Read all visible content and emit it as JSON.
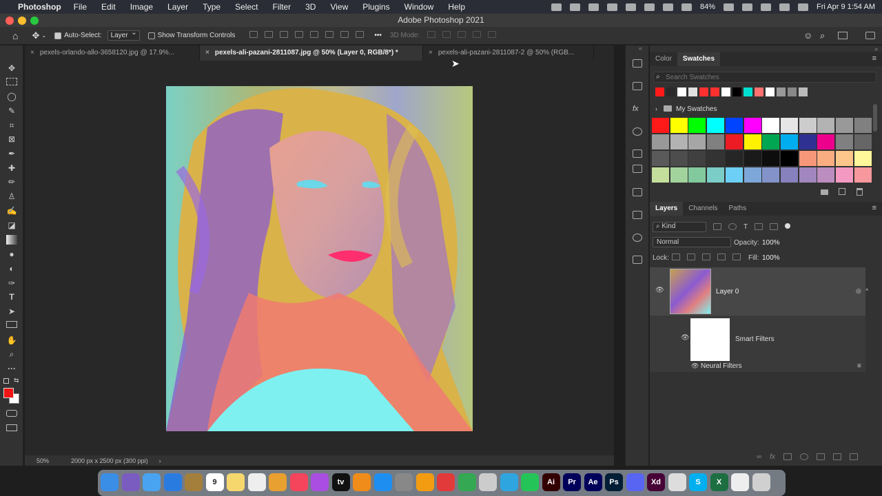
{
  "menubar": {
    "apple": "",
    "app": "Photoshop",
    "items": [
      "File",
      "Edit",
      "Image",
      "Layer",
      "Type",
      "Select",
      "Filter",
      "3D",
      "View",
      "Plugins",
      "Window",
      "Help"
    ],
    "battery": "84%",
    "datetime": "Fri Apr 9  1:54 AM"
  },
  "window": {
    "title": "Adobe Photoshop 2021"
  },
  "options": {
    "auto_select_label": "Auto-Select:",
    "auto_select_value": "Layer",
    "transform_label": "Show Transform Controls",
    "mode3d_label": "3D Mode:",
    "more": "•••"
  },
  "tabs": [
    {
      "label": "pexels-orlando-allo-3658120.jpg @ 17.9%..."
    },
    {
      "label": "pexels-ali-pazani-2811087.jpg @ 50% (Layer 0, RGB/8*) *"
    },
    {
      "label": "pexels-ali-pazani-2811087-2 @ 50% (RGB..."
    }
  ],
  "status": {
    "zoom": "50%",
    "doc_info": "2000 px x 2500 px (300 ppi)",
    "arrow": "›"
  },
  "colors": {
    "foreground": "#f01414",
    "background": "#ffffff",
    "accent": "#31a8ff"
  },
  "swatches_panel": {
    "tab_color": "Color",
    "tab_swatches": "Swatches",
    "search_placeholder": "Search Swatches",
    "recent": [
      "#ff1a1a",
      "#2a2a2a",
      "#ffffff",
      "#e0e0e0",
      "#ff3030",
      "#ff3030",
      "#ffffff",
      "#000000",
      "#00e0d0",
      "#ff7070",
      "#ffffff",
      "#999999",
      "#888888",
      "#bbbbbb"
    ],
    "group": "My Swatches",
    "rows": [
      [
        "#ff1a1a",
        "#ffff00",
        "#00ff00",
        "#00ffff",
        "#0044ff",
        "#ff00ff",
        "#ffffff",
        "#e6e6e6",
        "#cccccc",
        "#b3b3b3",
        "#999999",
        "#808080"
      ],
      [
        "#999999",
        "#b3b3b3",
        "#a6a6a6",
        "#808080",
        "#ed1c24",
        "#fff200",
        "#00a651",
        "#00aeef",
        "#2e3192",
        "#ec008c",
        "#808080",
        "#666666"
      ],
      [
        "#5a5a5a",
        "#4d4d4d",
        "#404040",
        "#333333",
        "#262626",
        "#1a1a1a",
        "#0d0d0d",
        "#000000",
        "#f7977a",
        "#f9ad81",
        "#fdc68a",
        "#fff79a"
      ],
      [
        "#c4df9b",
        "#a3d39c",
        "#82ca9d",
        "#7bcdc8",
        "#6dcff6",
        "#7da7d9",
        "#8393ca",
        "#8781bd",
        "#a187be",
        "#bc8dbf",
        "#f49ac2",
        "#f6989d"
      ]
    ]
  },
  "layers_panel": {
    "tab_layers": "Layers",
    "tab_channels": "Channels",
    "tab_paths": "Paths",
    "kind": "Kind",
    "blend_mode": "Normal",
    "opacity_label": "Opacity:",
    "opacity_value": "100%",
    "lock_label": "Lock:",
    "fill_label": "Fill:",
    "fill_value": "100%",
    "layer_name": "Layer 0",
    "smart_filters": "Smart Filters",
    "neural_filters": "Neural Filters"
  },
  "dock": [
    {
      "name": "Finder",
      "color": "#3a8ee6"
    },
    {
      "name": "Siri",
      "color": "#7a5cc0"
    },
    {
      "name": "Mail",
      "color": "#4aa3f0"
    },
    {
      "name": "Safari",
      "color": "#2a7be0"
    },
    {
      "name": "Notes",
      "color": "#a47f3c"
    },
    {
      "name": "Calendar",
      "color": "#ffffff",
      "label": "9"
    },
    {
      "name": "Stickies",
      "color": "#f5d76e"
    },
    {
      "name": "Reminders",
      "color": "#eeeeee"
    },
    {
      "name": "Photos",
      "color": "#e8a030"
    },
    {
      "name": "Music",
      "color": "#f5455c"
    },
    {
      "name": "Podcasts",
      "color": "#a94ee0"
    },
    {
      "name": "TV",
      "color": "#111111",
      "label": "tv"
    },
    {
      "name": "Books",
      "color": "#f08c1a"
    },
    {
      "name": "App Store",
      "color": "#1e8ef0"
    },
    {
      "name": "Settings",
      "color": "#888888"
    },
    {
      "name": "VLC",
      "color": "#f39c12"
    },
    {
      "name": "Screencast",
      "color": "#e23a3a"
    },
    {
      "name": "Chrome",
      "color": "#34a853"
    },
    {
      "name": "Preview",
      "color": "#cccccc"
    },
    {
      "name": "Filmora",
      "color": "#2fa5e0"
    },
    {
      "name": "Messages",
      "color": "#25c458"
    },
    {
      "name": "Illustrator",
      "color": "#330000",
      "label": "Ai"
    },
    {
      "name": "Premiere",
      "color": "#00005b",
      "label": "Pr"
    },
    {
      "name": "After Effects",
      "color": "#00005b",
      "label": "Ae"
    },
    {
      "name": "Photoshop",
      "color": "#001e36",
      "label": "Ps"
    },
    {
      "name": "Discord",
      "color": "#5865f2"
    },
    {
      "name": "XD",
      "color": "#470137",
      "label": "Xd"
    },
    {
      "name": "Utility",
      "color": "#dddddd"
    },
    {
      "name": "Skype",
      "color": "#00aff0",
      "label": "S"
    },
    {
      "name": "Excel",
      "color": "#1d6f42",
      "label": "X"
    },
    {
      "name": "Folder",
      "color": "#eeeeee"
    },
    {
      "name": "Trash",
      "color": "#d0d0d0"
    }
  ]
}
